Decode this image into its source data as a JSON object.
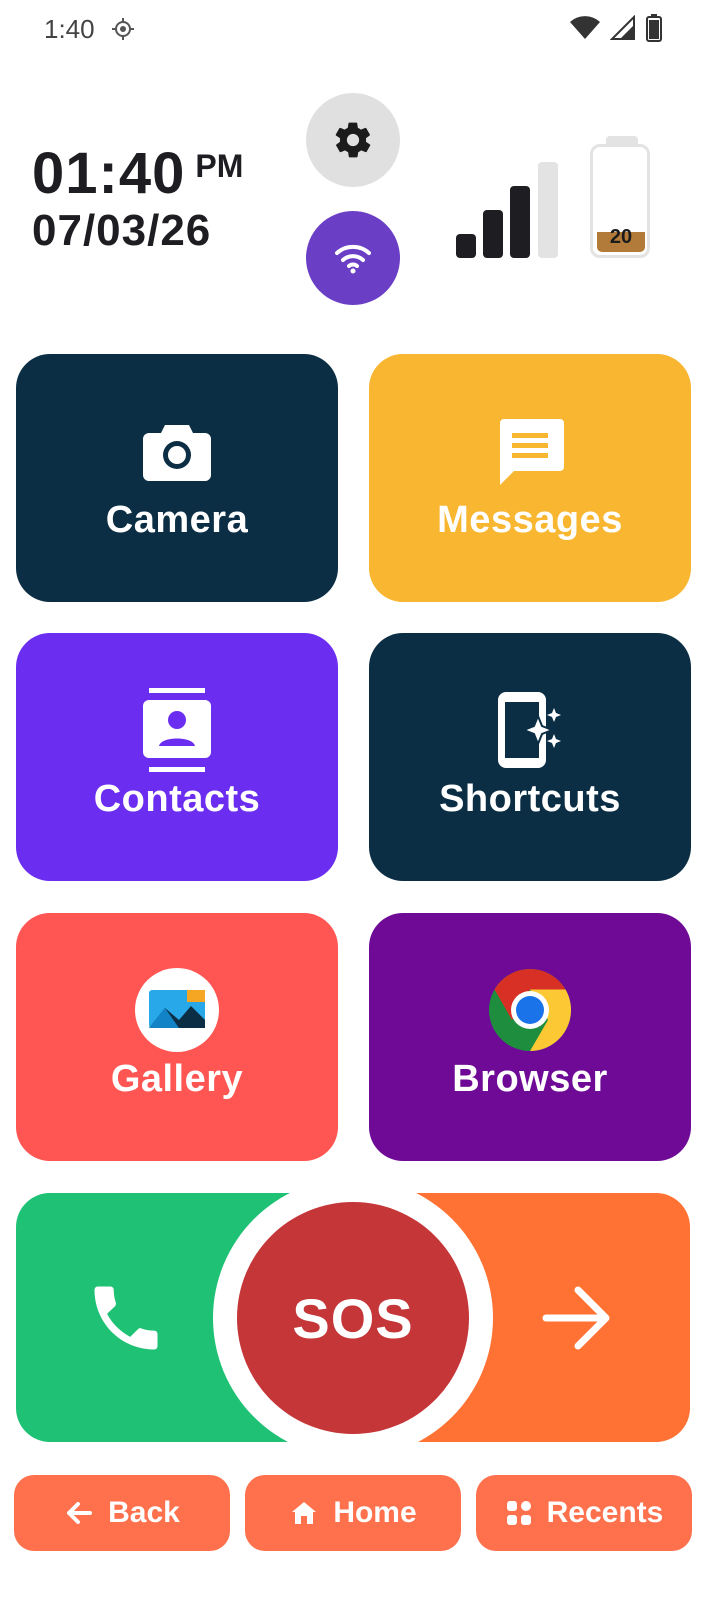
{
  "status_bar": {
    "time": "1:40",
    "icons": [
      "location-icon",
      "wifi-icon",
      "cell-signal-icon",
      "battery-icon"
    ]
  },
  "header": {
    "clock_time": "01:40",
    "clock_ampm": "PM",
    "date": "07/03/26",
    "settings_icon": "gear-icon",
    "wifi_icon": "wifi-icon",
    "signal_level": 3,
    "signal_max": 4,
    "battery_percent": "20"
  },
  "tiles": [
    {
      "label": "Camera",
      "icon": "camera-icon",
      "color": "#0b2e44"
    },
    {
      "label": "Messages",
      "icon": "message-icon",
      "color": "#f8b631"
    },
    {
      "label": "Contacts",
      "icon": "contacts-icon",
      "color": "#6b2ef0"
    },
    {
      "label": "Shortcuts",
      "icon": "shortcuts-icon",
      "color": "#0b2e44"
    },
    {
      "label": "Gallery",
      "icon": "gallery-icon",
      "color": "#ff5553"
    },
    {
      "label": "Browser",
      "icon": "chrome-icon",
      "color": "#6e0a96"
    }
  ],
  "sos_bar": {
    "sos_label": "SOS",
    "left_icon": "phone-icon",
    "right_icon": "arrow-right-icon",
    "left_color": "#1fc174",
    "right_color": "#ff7233",
    "sos_color": "#c43638"
  },
  "nav": {
    "back_label": "Back",
    "home_label": "Home",
    "recents_label": "Recents",
    "color": "#ff714d"
  }
}
